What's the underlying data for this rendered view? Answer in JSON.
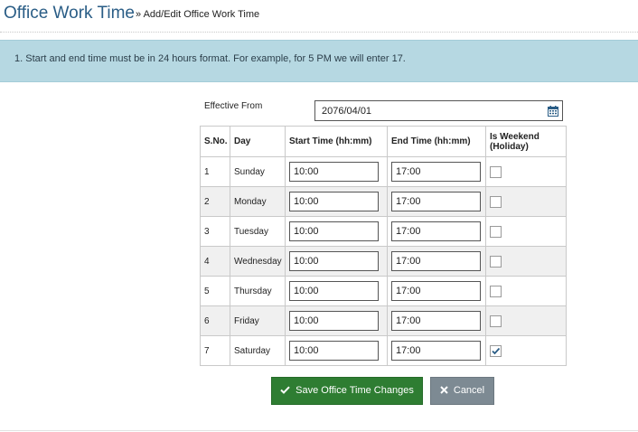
{
  "header": {
    "title": "Office Work Time",
    "subtitle": "» Add/Edit Office Work Time"
  },
  "alert": {
    "text": "1. Start and end time must be in 24 hours format. For example, for 5 PM we will enter 17."
  },
  "form": {
    "effective_label": "Effective From",
    "effective_value": "2076/04/01"
  },
  "table": {
    "headers": {
      "sno": "S.No.",
      "day": "Day",
      "start": "Start Time (hh:mm)",
      "end": "End Time (hh:mm)",
      "weekend": "Is Weekend (Holiday)"
    },
    "rows": [
      {
        "sno": "1",
        "day": "Sunday",
        "start": "10:00",
        "end": "17:00",
        "weekend": false
      },
      {
        "sno": "2",
        "day": "Monday",
        "start": "10:00",
        "end": "17:00",
        "weekend": false
      },
      {
        "sno": "3",
        "day": "Tuesday",
        "start": "10:00",
        "end": "17:00",
        "weekend": false
      },
      {
        "sno": "4",
        "day": "Wednesday",
        "start": "10:00",
        "end": "17:00",
        "weekend": false
      },
      {
        "sno": "5",
        "day": "Thursday",
        "start": "10:00",
        "end": "17:00",
        "weekend": false
      },
      {
        "sno": "6",
        "day": "Friday",
        "start": "10:00",
        "end": "17:00",
        "weekend": false
      },
      {
        "sno": "7",
        "day": "Saturday",
        "start": "10:00",
        "end": "17:00",
        "weekend": true
      }
    ]
  },
  "buttons": {
    "save_label": "Save Office Time Changes",
    "cancel_label": "Cancel"
  },
  "icons": {
    "calendar": "calendar-icon",
    "save": "check-icon",
    "cancel": "times-icon"
  },
  "colors": {
    "title": "#2a5d86",
    "alert_bg": "#b6d8e2",
    "save_button": "#2e7d32",
    "cancel_button": "#7d8a93",
    "checkbox_check": "#2a5d86"
  }
}
